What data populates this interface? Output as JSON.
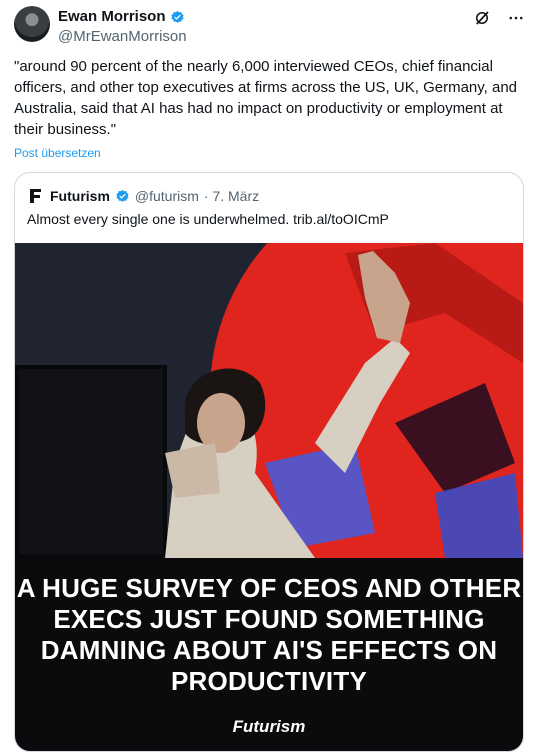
{
  "author": {
    "name": "Ewan Morrison",
    "handle": "@MrEwanMorrison",
    "verified": true
  },
  "icons": {
    "grok": "grok-icon",
    "more": "more-options-icon",
    "verified": "verified-badge-icon"
  },
  "tweet": {
    "text": "\"around 90 percent of the nearly 6,000  interviewed CEOs, chief financial officers, and other top executives at firms across the US, UK, Germany, and Australia, said that AI has had no impact on productivity or employment at their business.\"",
    "translate_link": "Post übersetzen"
  },
  "quote": {
    "name": "Futurism",
    "handle": "@futurism",
    "date": "· 7. März",
    "text": "Almost every single one is underwhelmed. trib.al/toOICmP",
    "image": {
      "headline": "A HUGE SURVEY OF CEOS AND OTHER EXECS JUST FOUND SOMETHING DAMNING ABOUT AI'S EFFECTS ON PRODUCTIVITY",
      "brand": "Futurism"
    }
  },
  "colors": {
    "link": "#1d9bf0",
    "verified": "#1d9bf0",
    "secondary_text": "#536471",
    "accent_red": "#e0241e",
    "accent_blue": "#4a5bd6"
  }
}
